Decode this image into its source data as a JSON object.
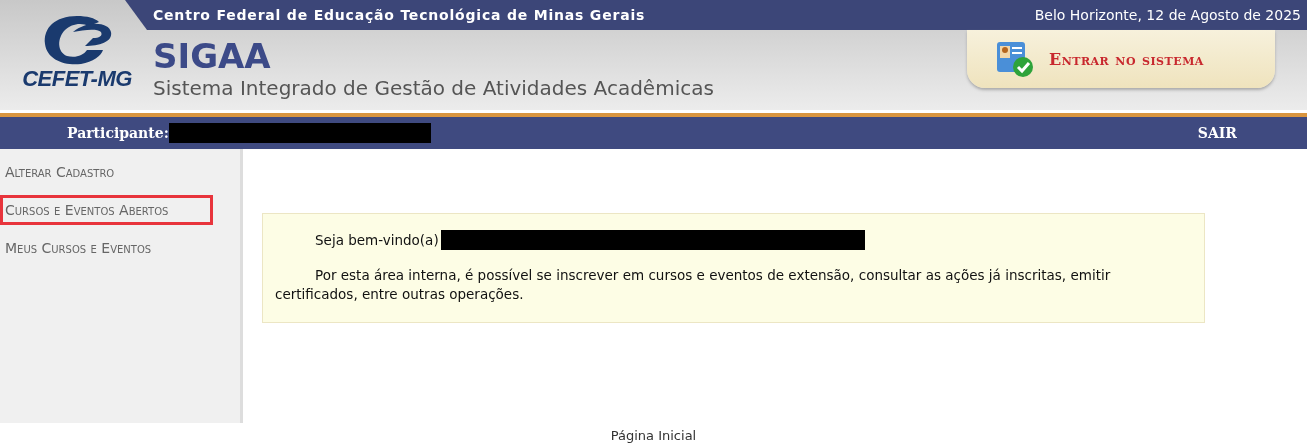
{
  "header": {
    "institution": "Centro Federal de Educação Tecnológica de Minas Gerais",
    "date": "Belo Horizonte, 12 de Agosto de 2025",
    "logo_text": "CEFET-MG",
    "system_name": "SIGAA",
    "system_subtitle": "Sistema Integrado de Gestão de Atividades Acadêmicas",
    "login_button": "Entrar no sistema"
  },
  "user_bar": {
    "label": "Participante:",
    "logout": "SAIR"
  },
  "sidebar": {
    "items": [
      {
        "label": "Alterar Cadastro",
        "highlighted": false
      },
      {
        "label": "Cursos e Eventos Abertos",
        "highlighted": true
      },
      {
        "label": "Meus Cursos e Eventos",
        "highlighted": false
      }
    ]
  },
  "welcome": {
    "greeting": "Seja bem-vindo(a)",
    "message": "Por esta área interna, é possível se inscrever em cursos e eventos de extensão, consultar as ações já inscritas, emitir certificados, entre outras operações."
  },
  "footer": {
    "text": "Página Inicial"
  }
}
